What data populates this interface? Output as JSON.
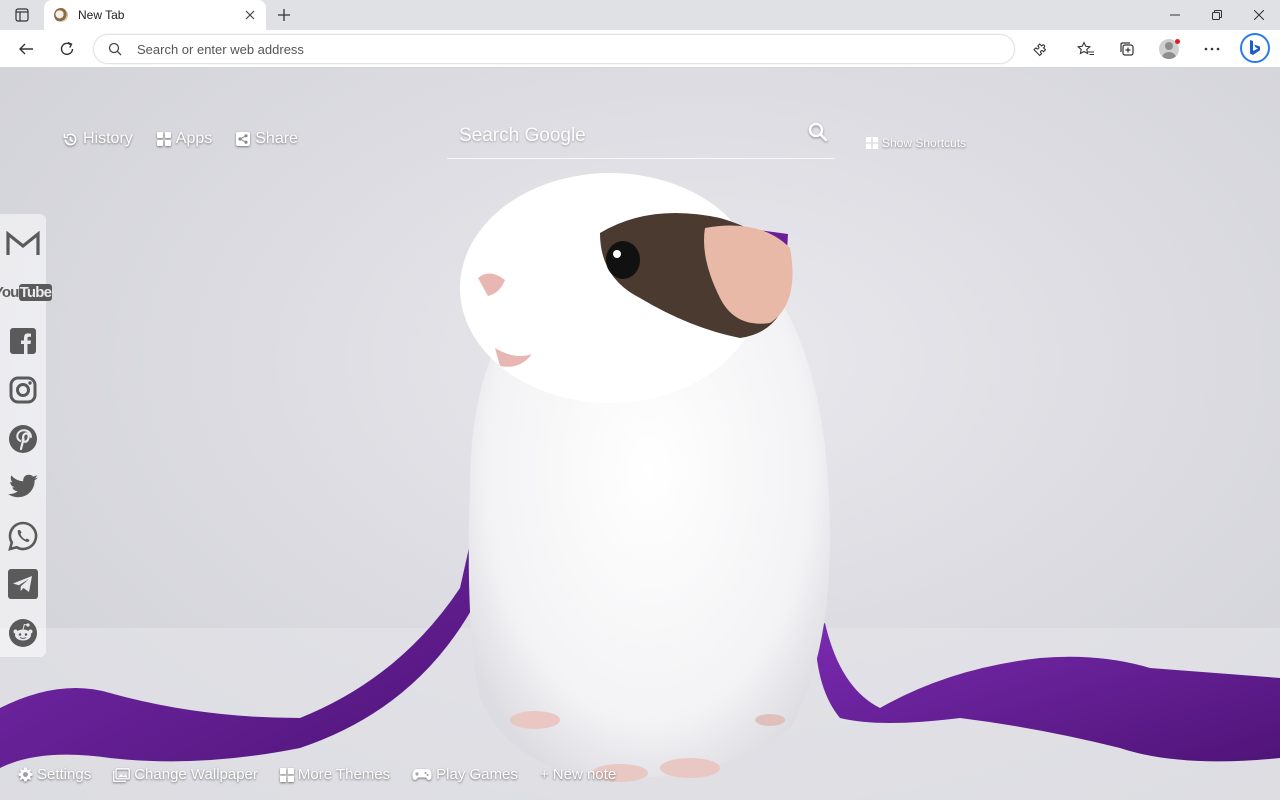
{
  "browser": {
    "tab": {
      "title": "New Tab"
    },
    "address_bar": {
      "placeholder": "Search or enter web address",
      "value": ""
    }
  },
  "topnav": {
    "history": "History",
    "apps": "Apps",
    "share": "Share"
  },
  "search": {
    "placeholder": "Search Google"
  },
  "shortcuts": {
    "label": "Show Shortcuts"
  },
  "social": [
    {
      "name": "gmail",
      "icon": "gmail-icon"
    },
    {
      "name": "youtube",
      "icon": "youtube-icon",
      "logo_text_a": "You",
      "logo_text_b": "Tube"
    },
    {
      "name": "facebook",
      "icon": "facebook-icon"
    },
    {
      "name": "instagram",
      "icon": "instagram-icon"
    },
    {
      "name": "pinterest",
      "icon": "pinterest-icon"
    },
    {
      "name": "twitter",
      "icon": "twitter-icon"
    },
    {
      "name": "whatsapp",
      "icon": "whatsapp-icon"
    },
    {
      "name": "telegram",
      "icon": "telegram-icon"
    },
    {
      "name": "reddit",
      "icon": "reddit-icon"
    }
  ],
  "bottombar": {
    "settings": "Settings",
    "change_wallpaper": "Change Wallpaper",
    "more_themes": "More Themes",
    "play_games": "Play Games",
    "new_note": "+ New note"
  },
  "colors": {
    "ribbon": "#6a1e9a",
    "wallpaper_bg": "#dcdce2",
    "social_icon": "#5a5a5a",
    "bing_accent": "#2a7de1"
  }
}
